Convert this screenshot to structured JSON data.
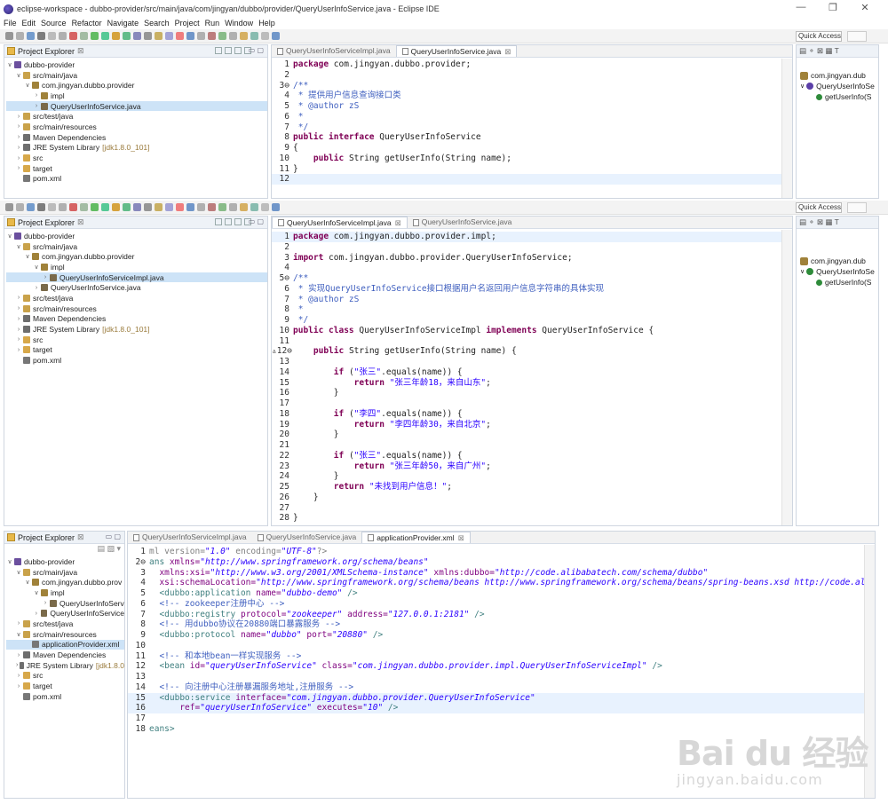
{
  "window": {
    "title": "eclipse-workspace - dubbo-provider/src/main/java/com/jingyan/dubbo/provider/QueryUserInfoService.java - Eclipse IDE",
    "controls": [
      "—",
      "❐",
      "✕"
    ]
  },
  "menu": [
    "File",
    "Edit",
    "Source",
    "Refactor",
    "Navigate",
    "Search",
    "Project",
    "Run",
    "Window",
    "Help"
  ],
  "toolbar": {
    "quick_access": "Quick Access"
  },
  "project_explorer": {
    "title": "Project Explorer",
    "close": "⊠",
    "section1": [
      {
        "indent": 0,
        "tw": "∨",
        "label": "dubbo-provider",
        "icon": "project"
      },
      {
        "indent": 1,
        "tw": "∨",
        "label": "src/main/java",
        "icon": "srcfolder"
      },
      {
        "indent": 2,
        "tw": "∨",
        "label": "com.jingyan.dubbo.provider",
        "icon": "package"
      },
      {
        "indent": 3,
        "tw": "›",
        "label": "impl",
        "icon": "package"
      },
      {
        "indent": 3,
        "tw": "›",
        "label": "QueryUserInfoService.java",
        "icon": "java",
        "sel": true
      },
      {
        "indent": 1,
        "tw": "›",
        "label": "src/test/java",
        "icon": "srcfolder"
      },
      {
        "indent": 1,
        "tw": "›",
        "label": "src/main/resources",
        "icon": "srcfolder"
      },
      {
        "indent": 1,
        "tw": "›",
        "label": "Maven Dependencies",
        "icon": "lib"
      },
      {
        "indent": 1,
        "tw": "›",
        "label": "JRE System Library",
        "dim": "[jdk1.8.0_101]",
        "icon": "lib"
      },
      {
        "indent": 1,
        "tw": "›",
        "label": "src",
        "icon": "folder"
      },
      {
        "indent": 1,
        "tw": "›",
        "label": "target",
        "icon": "folder"
      },
      {
        "indent": 1,
        "tw": "",
        "label": "pom.xml",
        "icon": "xml"
      }
    ],
    "section2": [
      {
        "indent": 0,
        "tw": "∨",
        "label": "dubbo-provider",
        "icon": "project"
      },
      {
        "indent": 1,
        "tw": "∨",
        "label": "src/main/java",
        "icon": "srcfolder"
      },
      {
        "indent": 2,
        "tw": "∨",
        "label": "com.jingyan.dubbo.provider",
        "icon": "package"
      },
      {
        "indent": 3,
        "tw": "∨",
        "label": "impl",
        "icon": "package"
      },
      {
        "indent": 4,
        "tw": "›",
        "label": "QueryUserInfoServiceImpl.java",
        "icon": "java",
        "sel": true
      },
      {
        "indent": 3,
        "tw": "›",
        "label": "QueryUserInfoService.java",
        "icon": "java"
      },
      {
        "indent": 1,
        "tw": "›",
        "label": "src/test/java",
        "icon": "srcfolder"
      },
      {
        "indent": 1,
        "tw": "›",
        "label": "src/main/resources",
        "icon": "srcfolder"
      },
      {
        "indent": 1,
        "tw": "›",
        "label": "Maven Dependencies",
        "icon": "lib"
      },
      {
        "indent": 1,
        "tw": "›",
        "label": "JRE System Library",
        "dim": "[jdk1.8.0_101]",
        "icon": "lib"
      },
      {
        "indent": 1,
        "tw": "›",
        "label": "src",
        "icon": "folder"
      },
      {
        "indent": 1,
        "tw": "›",
        "label": "target",
        "icon": "folder"
      },
      {
        "indent": 1,
        "tw": "",
        "label": "pom.xml",
        "icon": "xml"
      }
    ],
    "section3": [
      {
        "indent": 0,
        "tw": "∨",
        "label": "dubbo-provider",
        "icon": "project"
      },
      {
        "indent": 1,
        "tw": "∨",
        "label": "src/main/java",
        "icon": "srcfolder"
      },
      {
        "indent": 2,
        "tw": "∨",
        "label": "com.jingyan.dubbo.prov",
        "icon": "package"
      },
      {
        "indent": 3,
        "tw": "∨",
        "label": "impl",
        "icon": "package"
      },
      {
        "indent": 4,
        "tw": "›",
        "label": "QueryUserInfoServ",
        "icon": "java"
      },
      {
        "indent": 3,
        "tw": "›",
        "label": "QueryUserInfoService",
        "icon": "java"
      },
      {
        "indent": 1,
        "tw": "›",
        "label": "src/test/java",
        "icon": "srcfolder"
      },
      {
        "indent": 1,
        "tw": "∨",
        "label": "src/main/resources",
        "icon": "srcfolder"
      },
      {
        "indent": 2,
        "tw": "",
        "label": "applicationProvider.xml",
        "icon": "xml",
        "sel": true
      },
      {
        "indent": 1,
        "tw": "›",
        "label": "Maven Dependencies",
        "icon": "lib"
      },
      {
        "indent": 1,
        "tw": "›",
        "label": "JRE System Library",
        "dim": "[jdk1.8.0",
        "icon": "lib"
      },
      {
        "indent": 1,
        "tw": "›",
        "label": "src",
        "icon": "folder"
      },
      {
        "indent": 1,
        "tw": "›",
        "label": "target",
        "icon": "folder"
      },
      {
        "indent": 1,
        "tw": "",
        "label": "pom.xml",
        "icon": "xml"
      }
    ]
  },
  "editor1": {
    "tabs": [
      {
        "label": "QueryUserInfoServiceImpl.java",
        "active": false
      },
      {
        "label": "QueryUserInfoService.java",
        "active": true,
        "close": "⊠"
      }
    ],
    "lines": [
      {
        "n": "1",
        "html": "<span class='kw'>package</span> com.jingyan.dubbo.provider;"
      },
      {
        "n": "2",
        "html": ""
      },
      {
        "n": "3⊖",
        "html": "<span class='cm'>/**</span>"
      },
      {
        "n": "4",
        "html": "<span class='cm'> * 提供用户信息查询接口类</span>"
      },
      {
        "n": "5",
        "html": "<span class='cm'> * @author zS</span>"
      },
      {
        "n": "6",
        "html": "<span class='cm'> *</span>"
      },
      {
        "n": "7",
        "html": "<span class='cm'> */</span>"
      },
      {
        "n": "8",
        "html": "<span class='kw'>public interface</span> QueryUserInfoService"
      },
      {
        "n": "9",
        "html": "{"
      },
      {
        "n": "10",
        "html": "    <span class='kw'>public</span> String getUserInfo(String name);"
      },
      {
        "n": "11",
        "html": "}"
      },
      {
        "n": "12",
        "html": "",
        "cur": true
      }
    ]
  },
  "editor2": {
    "tabs": [
      {
        "label": "QueryUserInfoServiceImpl.java",
        "active": true,
        "close": "⊠"
      },
      {
        "label": "QueryUserInfoService.java",
        "active": false
      }
    ],
    "lines": [
      {
        "n": "1",
        "html": "<span class='kw'>package</span> com.jingyan.dubbo.provider.impl;",
        "cur": true
      },
      {
        "n": "2",
        "html": ""
      },
      {
        "n": "3",
        "html": "<span class='kw'>import</span> com.jingyan.dubbo.provider.QueryUserInfoService;"
      },
      {
        "n": "4",
        "html": ""
      },
      {
        "n": "5⊖",
        "html": "<span class='cm'>/**</span>"
      },
      {
        "n": "6",
        "html": "<span class='cm'> * 实现QueryUserInfoService接口根据用户名返回用户信息字符串的具体实现</span>"
      },
      {
        "n": "7",
        "html": "<span class='cm'> * @author zS</span>"
      },
      {
        "n": "8",
        "html": "<span class='cm'> *</span>"
      },
      {
        "n": "9",
        "html": "<span class='cm'> */</span>"
      },
      {
        "n": "10",
        "html": "<span class='kw'>public class</span> QueryUserInfoServiceImpl <span class='kw'>implements</span> QueryUserInfoService {"
      },
      {
        "n": "11",
        "html": ""
      },
      {
        "n": "▵12⊖",
        "html": "    <span class='kw'>public</span> String getUserInfo(String name) {"
      },
      {
        "n": "13",
        "html": ""
      },
      {
        "n": "14",
        "html": "        <span class='kw'>if</span> (<span class='st'>\"张三\"</span>.equals(name)) {"
      },
      {
        "n": "15",
        "html": "            <span class='kw'>return</span> <span class='st'>\"张三年龄18，来自山东\"</span>;"
      },
      {
        "n": "16",
        "html": "        }"
      },
      {
        "n": "17",
        "html": ""
      },
      {
        "n": "18",
        "html": "        <span class='kw'>if</span> (<span class='st'>\"李四\"</span>.equals(name)) {"
      },
      {
        "n": "19",
        "html": "            <span class='kw'>return</span> <span class='st'>\"李四年龄30，来自北京\"</span>;"
      },
      {
        "n": "20",
        "html": "        }"
      },
      {
        "n": "21",
        "html": ""
      },
      {
        "n": "22",
        "html": "        <span class='kw'>if</span> (<span class='st'>\"张三\"</span>.equals(name)) {"
      },
      {
        "n": "23",
        "html": "            <span class='kw'>return</span> <span class='st'>\"张三年龄50，来自广州\"</span>;"
      },
      {
        "n": "24",
        "html": "        }"
      },
      {
        "n": "25",
        "html": "        <span class='kw'>return</span> <span class='st'>\"未找到用户信息！\"</span>;"
      },
      {
        "n": "26",
        "html": "    }"
      },
      {
        "n": "27",
        "html": ""
      },
      {
        "n": "28",
        "html": "}"
      }
    ]
  },
  "editor3": {
    "tabs": [
      {
        "label": "QueryUserInfoServiceImpl.java",
        "active": false
      },
      {
        "label": "QueryUserInfoService.java",
        "active": false
      },
      {
        "label": "applicationProvider.xml",
        "active": true,
        "close": "⊠"
      }
    ],
    "lines": [
      {
        "n": "1",
        "html": "<span class='xpi'>ml version=</span><span class='aval'>\"1.0\"</span><span class='xpi'> encoding=</span><span class='aval'>\"UTF-8\"</span><span class='xpi'>?&gt;</span>"
      },
      {
        "n": "2⊖",
        "html": "<span class='tag'>ans</span> <span class='attr'>xmlns=</span><span class='aval'>\"http://www.springframework.org/schema/beans\"</span>"
      },
      {
        "n": "3",
        "html": "  <span class='attr'>xmlns:xsi=</span><span class='aval'>\"http://www.w3.org/2001/XMLSchema-instance\"</span> <span class='attr'>xmlns:dubbo=</span><span class='aval'>\"http://code.alibabatech.com/schema/dubbo\"</span>"
      },
      {
        "n": "4",
        "html": "  <span class='attr'>xsi:schemaLocation=</span><span class='aval'>\"http://www.springframework.org/schema/beans http://www.springframework.org/schema/beans/spring-beans.xsd http://code.alib</span>"
      },
      {
        "n": "5",
        "html": "  <span class='tag'>&lt;dubbo:application</span> <span class='attr'>name=</span><span class='aval'>\"dubbo-demo\"</span> <span class='tag'>/&gt;</span>"
      },
      {
        "n": "6",
        "html": "  <span class='xcm'>&lt;!-- zookeeper注册中心 --&gt;</span>"
      },
      {
        "n": "7",
        "html": "  <span class='tag'>&lt;dubbo:registry</span> <span class='attr'>protocol=</span><span class='aval'>\"zookeeper\"</span> <span class='attr'>address=</span><span class='aval'>\"127.0.0.1:2181\"</span> <span class='tag'>/&gt;</span>"
      },
      {
        "n": "8",
        "html": "  <span class='xcm'>&lt;!-- 用dubbo协议在20880端口暴露服务 --&gt;</span>"
      },
      {
        "n": "9",
        "html": "  <span class='tag'>&lt;dubbo:protocol</span> <span class='attr'>name=</span><span class='aval'>\"dubbo\"</span> <span class='attr'>port=</span><span class='aval'>\"20880\"</span> <span class='tag'>/&gt;</span>"
      },
      {
        "n": "10",
        "html": ""
      },
      {
        "n": "11",
        "html": "  <span class='xcm'>&lt;!-- 和本地bean一样实现服务 --&gt;</span>"
      },
      {
        "n": "12",
        "html": "  <span class='tag'>&lt;bean</span> <span class='attr'>id=</span><span class='aval'>\"queryUserInfoService\"</span> <span class='attr'>class=</span><span class='aval'>\"com.jingyan.dubbo.provider.impl.QueryUserInfoServiceImpl\"</span> <span class='tag'>/&gt;</span>"
      },
      {
        "n": "13",
        "html": ""
      },
      {
        "n": "14",
        "html": "  <span class='xcm'>&lt;!-- 向注册中心注册暴漏服务地址,注册服务 --&gt;</span>"
      },
      {
        "n": "15",
        "html": "  <span class='tag'>&lt;dubbo:service</span> <span class='attr'>interface=</span><span class='aval'>\"com.jingyan.dubbo.provider.QueryUserInfoService\"</span>",
        "cur": true
      },
      {
        "n": "16",
        "html": "      <span class='attr'>ref=</span><span class='aval'>\"queryUserInfoService\"</span> <span class='attr'>executes=</span><span class='aval'>\"10\"</span> <span class='tag'>/&gt;</span>",
        "cur": true
      },
      {
        "n": "17",
        "html": ""
      },
      {
        "n": "18",
        "html": "<span class='tag'>eans&gt;</span>"
      }
    ]
  },
  "outline1": {
    "items": [
      {
        "label": "com.jingyan.dub",
        "icon": "package"
      },
      {
        "label": "QueryUserInfoSe",
        "icon": "interface",
        "tw": "∨"
      },
      {
        "label": "getUserInfo(S",
        "icon": "method",
        "indent": true
      }
    ]
  },
  "outline2": {
    "items": [
      {
        "label": "com.jingyan.dub",
        "icon": "package"
      },
      {
        "label": "QueryUserInfoSe",
        "icon": "class",
        "tw": "∨"
      },
      {
        "label": "getUserInfo(S",
        "icon": "method",
        "indent": true
      }
    ]
  },
  "watermark": {
    "big": "Bai du 经验",
    "small": "jingyan.baidu.com"
  }
}
